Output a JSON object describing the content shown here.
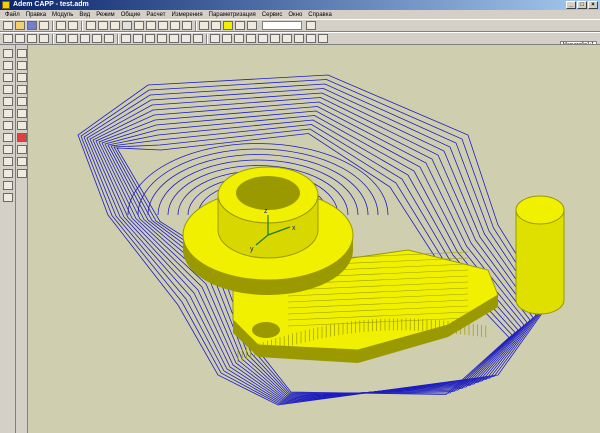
{
  "window": {
    "title": "Adem CAPP - test.adm",
    "app_icon": "adem-app-icon",
    "controls": [
      "minimize-icon",
      "maximize-icon",
      "close-icon"
    ]
  },
  "menu": {
    "items": [
      "Файл",
      "Правка",
      "Модуль",
      "Вид",
      "Режим",
      "Общие",
      "Расчет",
      "Измерения",
      "Параметризация",
      "Сервис",
      "Окно",
      "Справка"
    ]
  },
  "toolbar": {
    "zoom_label": "Масштаб=1:1"
  },
  "scene": {
    "background": "#cfcfb0",
    "part_color": "#f0f000",
    "part_shadow": "#9a9a00",
    "toolpath_color": "#1d1dbf",
    "axis_x": "x",
    "axis_y": "y",
    "axis_z": "z"
  }
}
